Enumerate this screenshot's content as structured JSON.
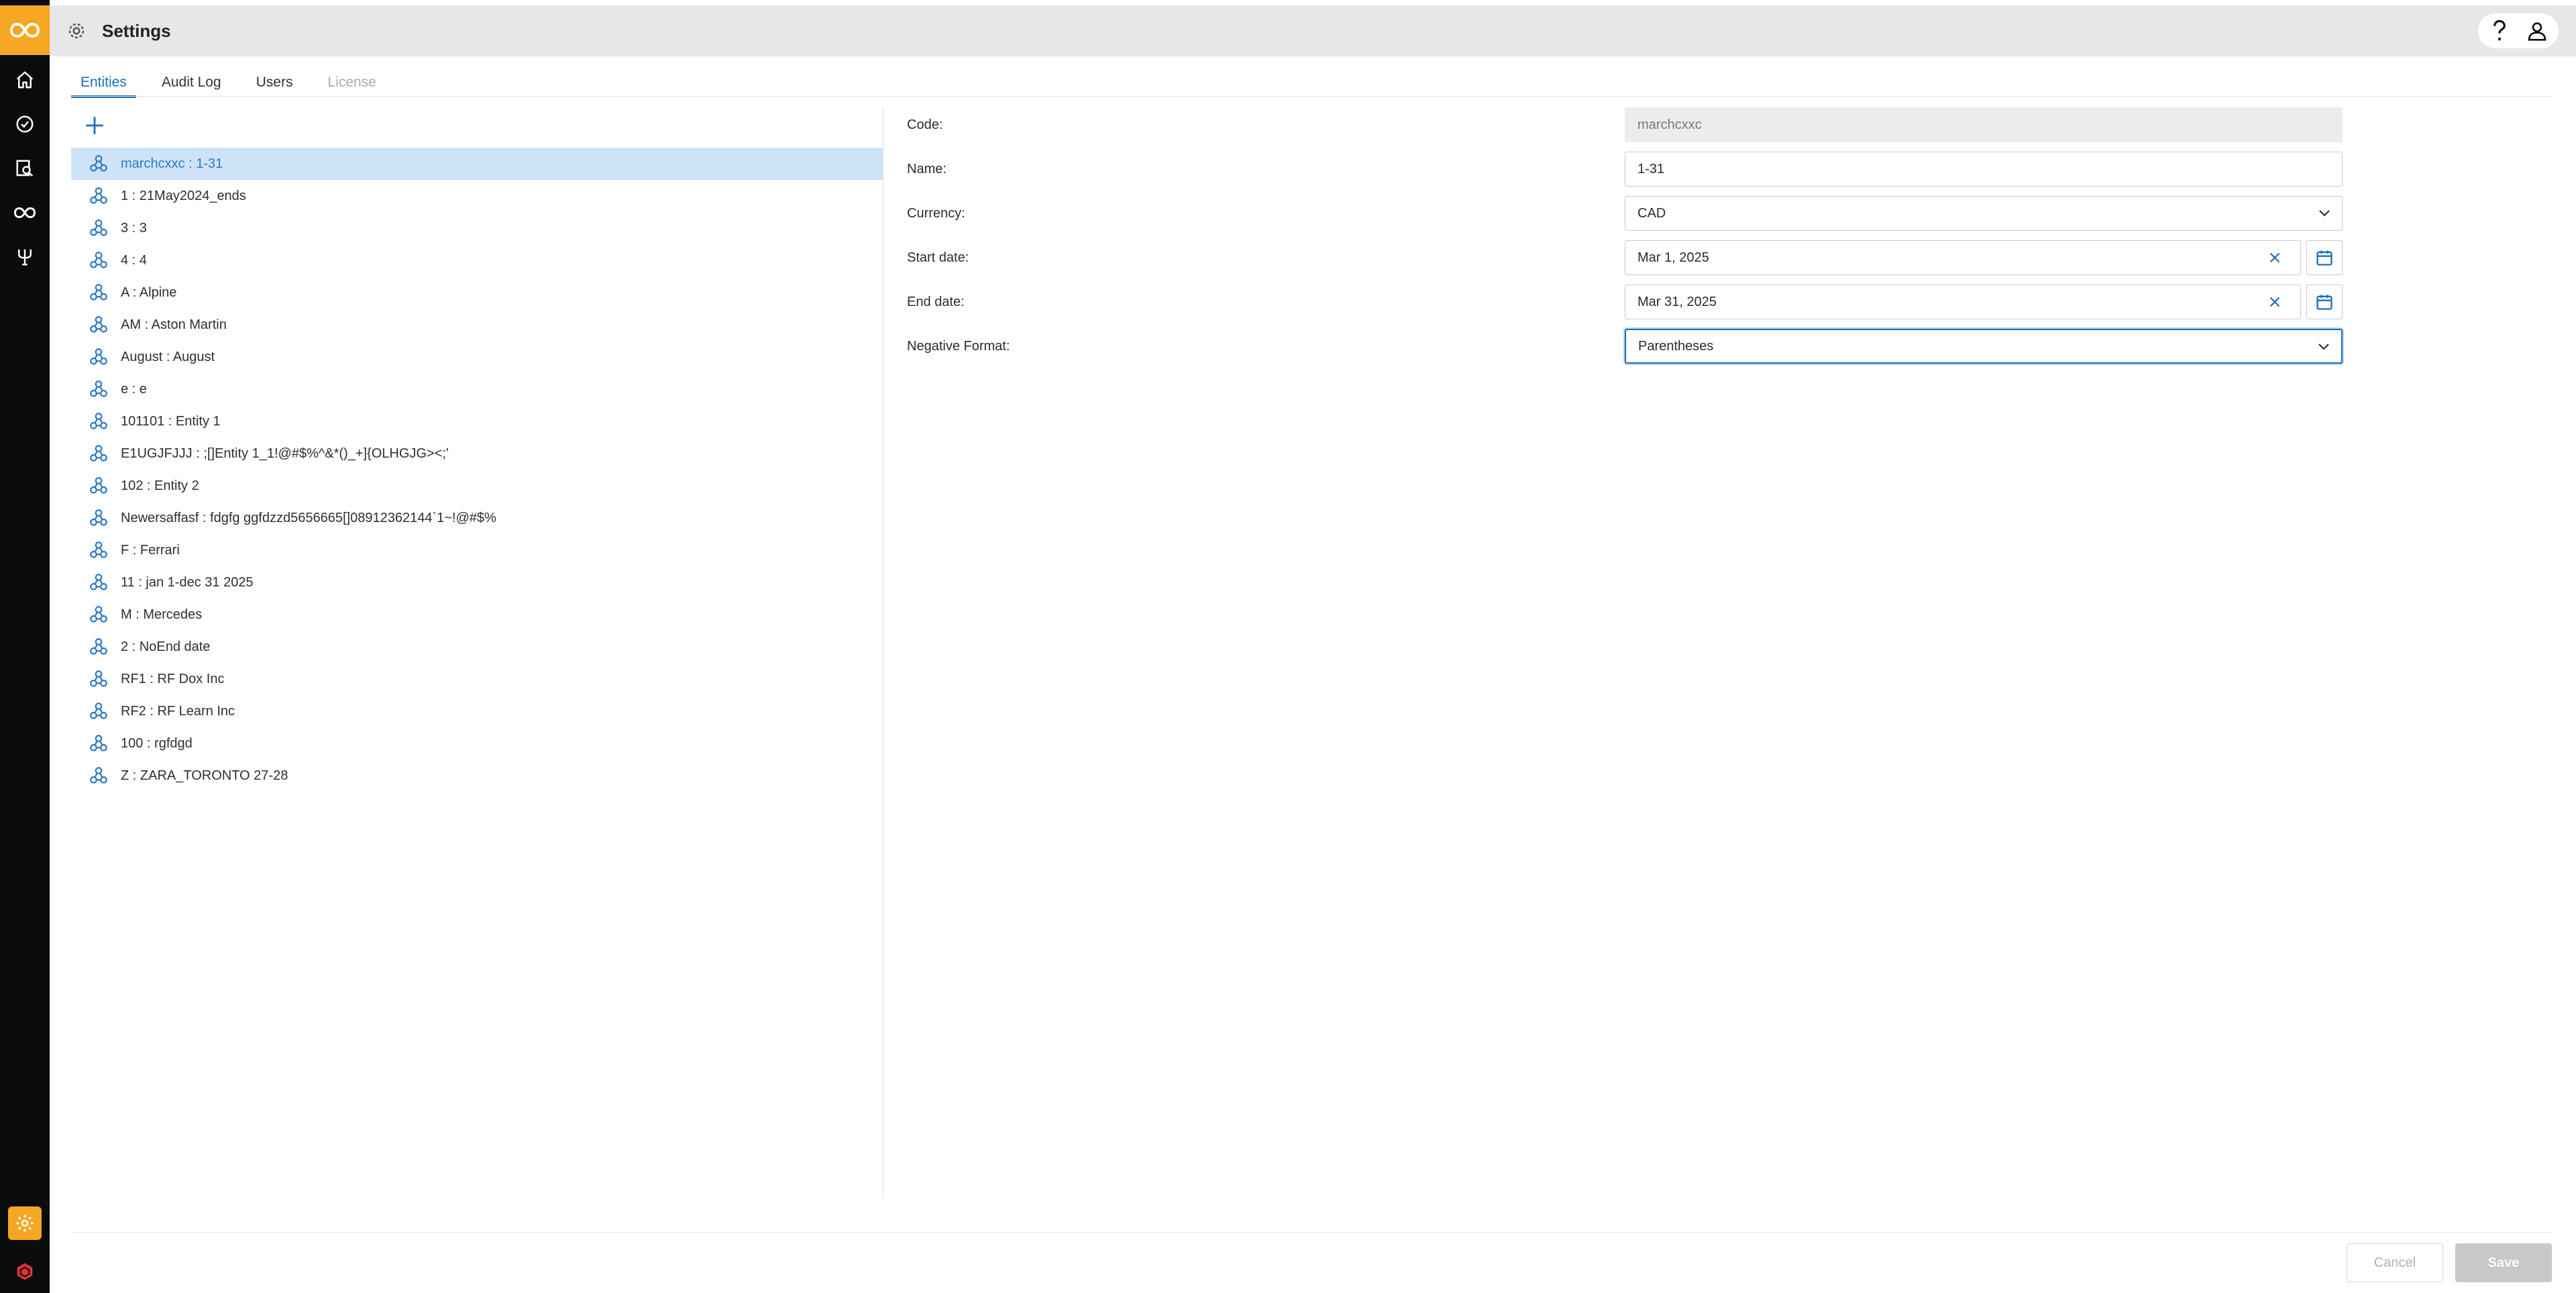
{
  "app": {
    "rail_items": [
      {
        "name": "home-icon"
      },
      {
        "name": "check-circle-icon"
      },
      {
        "name": "search-report-icon"
      },
      {
        "name": "infinity-icon"
      },
      {
        "name": "fork-icon"
      }
    ],
    "rail_bottom": [
      {
        "name": "settings-icon"
      },
      {
        "name": "cube-brand-icon"
      }
    ]
  },
  "header": {
    "title": "Settings",
    "help_icon": "question-icon",
    "user_icon": "user-icon"
  },
  "tabs": [
    {
      "label": "Entities",
      "state": "active"
    },
    {
      "label": "Audit Log",
      "state": "normal"
    },
    {
      "label": "Users",
      "state": "normal"
    },
    {
      "label": "License",
      "state": "disabled"
    }
  ],
  "entities": [
    {
      "label": "marchcxxc : 1-31",
      "selected": true
    },
    {
      "label": "1 : 21May2024_ends"
    },
    {
      "label": "3 : 3"
    },
    {
      "label": "4 : 4"
    },
    {
      "label": "A : Alpine"
    },
    {
      "label": "AM : Aston Martin"
    },
    {
      "label": "August : August"
    },
    {
      "label": "e : e"
    },
    {
      "label": "101101 : Entity 1"
    },
    {
      "label": "E1UGJFJJJ : ;[]Entity 1_1!@#$%^&*()_+]{OLHGJG><;'"
    },
    {
      "label": "102 : Entity 2"
    },
    {
      "label": "Newersaffasf : fdgfg ggfdzzd5656665[]08912362144`1~!@#$%"
    },
    {
      "label": "F : Ferrari"
    },
    {
      "label": "11 : jan 1-dec 31 2025"
    },
    {
      "label": "M : Mercedes"
    },
    {
      "label": "2 : NoEnd date"
    },
    {
      "label": "RF1 : RF Dox Inc"
    },
    {
      "label": "RF2 : RF Learn Inc"
    },
    {
      "label": "100 : rgfdgd"
    },
    {
      "label": "Z : ZARA_TORONTO 27-28"
    }
  ],
  "form": {
    "code_label": "Code:",
    "code_value": "marchcxxc",
    "name_label": "Name:",
    "name_value": "1-31",
    "currency_label": "Currency:",
    "currency_value": "CAD",
    "start_label": "Start date:",
    "start_value": "Mar 1, 2025",
    "end_label": "End date:",
    "end_value": "Mar 31, 2025",
    "negative_label": "Negative Format:",
    "negative_value": "Parentheses"
  },
  "footer": {
    "cancel_label": "Cancel",
    "save_label": "Save"
  },
  "colors": {
    "accent": "#1a6fb5",
    "brand": "#f5a623",
    "rail": "#0b0b0b",
    "selected_row": "#cfe3f8"
  }
}
